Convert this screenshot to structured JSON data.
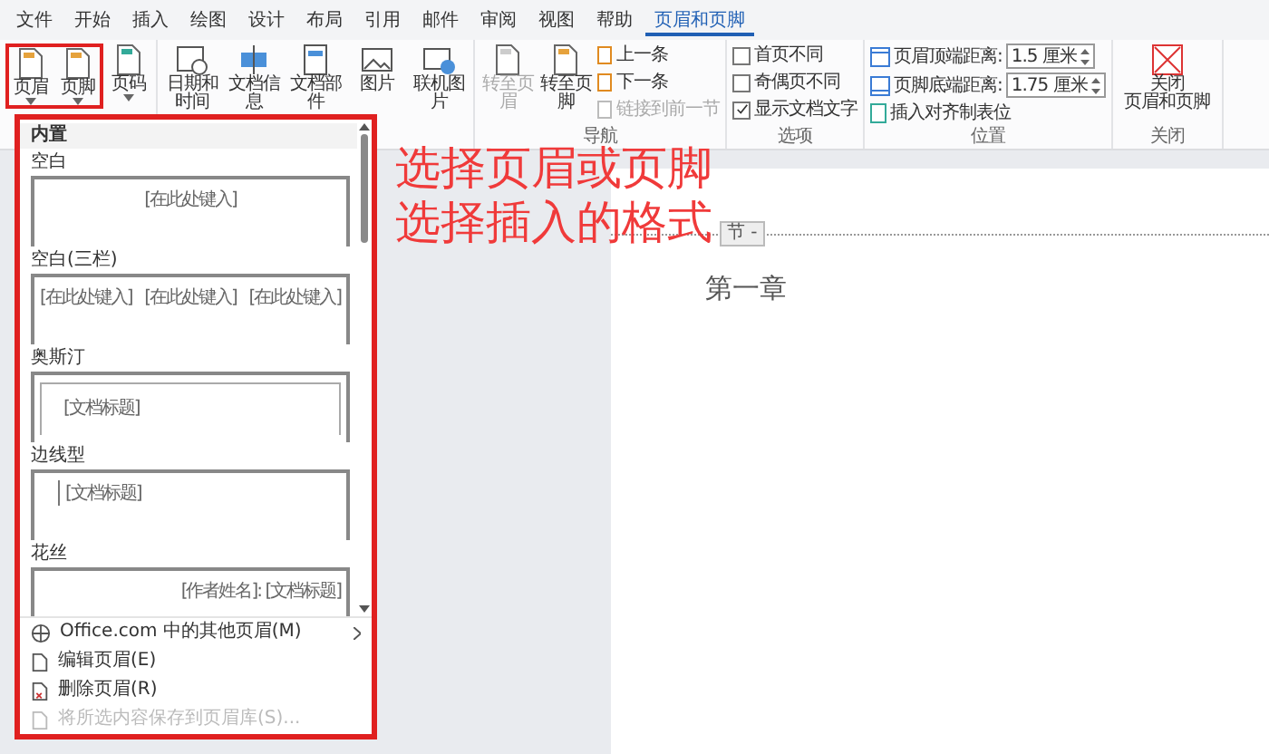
{
  "menu_tabs": [
    {
      "label": "文件",
      "selected": false
    },
    {
      "label": "开始",
      "selected": false
    },
    {
      "label": "插入",
      "selected": false
    },
    {
      "label": "绘图",
      "selected": false
    },
    {
      "label": "设计",
      "selected": false
    },
    {
      "label": "布局",
      "selected": false
    },
    {
      "label": "引用",
      "selected": false
    },
    {
      "label": "邮件",
      "selected": false
    },
    {
      "label": "审阅",
      "selected": false
    },
    {
      "label": "视图",
      "selected": false
    },
    {
      "label": "帮助",
      "selected": false
    },
    {
      "label": "页眉和页脚",
      "selected": true
    }
  ],
  "ribbon": {
    "header_footer": [
      {
        "label": "页眉",
        "marked": true
      },
      {
        "label": "页脚",
        "marked": true
      },
      {
        "label": "页码",
        "marked": false
      }
    ],
    "insert": [
      {
        "label": "日期和时间",
        "kind": "clock"
      },
      {
        "label": "文档信息",
        "kind": "info"
      },
      {
        "label": "文档部件",
        "kind": "parts"
      },
      {
        "label": "图片",
        "kind": "picture"
      },
      {
        "label": "联机图片",
        "kind": "online"
      }
    ],
    "navigation": {
      "label": "导航",
      "large": [
        {
          "label": "转至页眉",
          "disabled": true
        },
        {
          "label": "转至页脚",
          "disabled": false
        }
      ],
      "small": [
        {
          "label": "上一条",
          "disabled": false
        },
        {
          "label": "下一条",
          "disabled": false
        },
        {
          "label": "链接到前一节",
          "disabled": true
        }
      ]
    },
    "options": {
      "label": "选项",
      "checks": [
        {
          "label": "首页不同",
          "checked": false
        },
        {
          "label": "奇偶页不同",
          "checked": false
        },
        {
          "label": "显示文档文字",
          "checked": true
        }
      ]
    },
    "position": {
      "label": "位置",
      "fields": [
        {
          "label": "页眉顶端距离:",
          "value": "1.5 厘米"
        },
        {
          "label": "页脚底端距离:",
          "value": "1.75 厘米"
        }
      ],
      "action": "插入对齐制表位"
    },
    "close": {
      "label": "关闭",
      "button": [
        "关闭",
        "页眉和页脚"
      ]
    }
  },
  "gallery": {
    "section": "内置",
    "items": [
      {
        "name": "空白",
        "kind": "center",
        "preview": [
          "[在此处键入]"
        ]
      },
      {
        "name": "空白(三栏)",
        "kind": "three",
        "preview": [
          "[在此处键入]",
          "[在此处键入]",
          "[在此处键入]"
        ]
      },
      {
        "name": "奥斯汀",
        "kind": "framed",
        "preview": [
          "[文档标题]"
        ]
      },
      {
        "name": "边线型",
        "kind": "bar",
        "preview": [
          "[文档标题]"
        ]
      },
      {
        "name": "花丝",
        "kind": "right",
        "preview": [
          "[作者姓名]: [文档标题]"
        ]
      }
    ],
    "menu": [
      {
        "label": "Office.com 中的其他页眉(M)",
        "kind": "globe",
        "disabled": false,
        "submenu": true
      },
      {
        "label": "编辑页眉(E)",
        "kind": "edit",
        "disabled": false,
        "submenu": false
      },
      {
        "label": "删除页眉(R)",
        "kind": "delete",
        "disabled": false,
        "submenu": false
      },
      {
        "label": "将所选内容保存到页眉库(S)...",
        "kind": "save",
        "disabled": true,
        "submenu": false
      }
    ]
  },
  "annotation": {
    "lines": [
      "选择页眉或页脚",
      "选择插入的格式"
    ]
  },
  "document": {
    "section_tag": "节 -",
    "heading": "第一章"
  }
}
